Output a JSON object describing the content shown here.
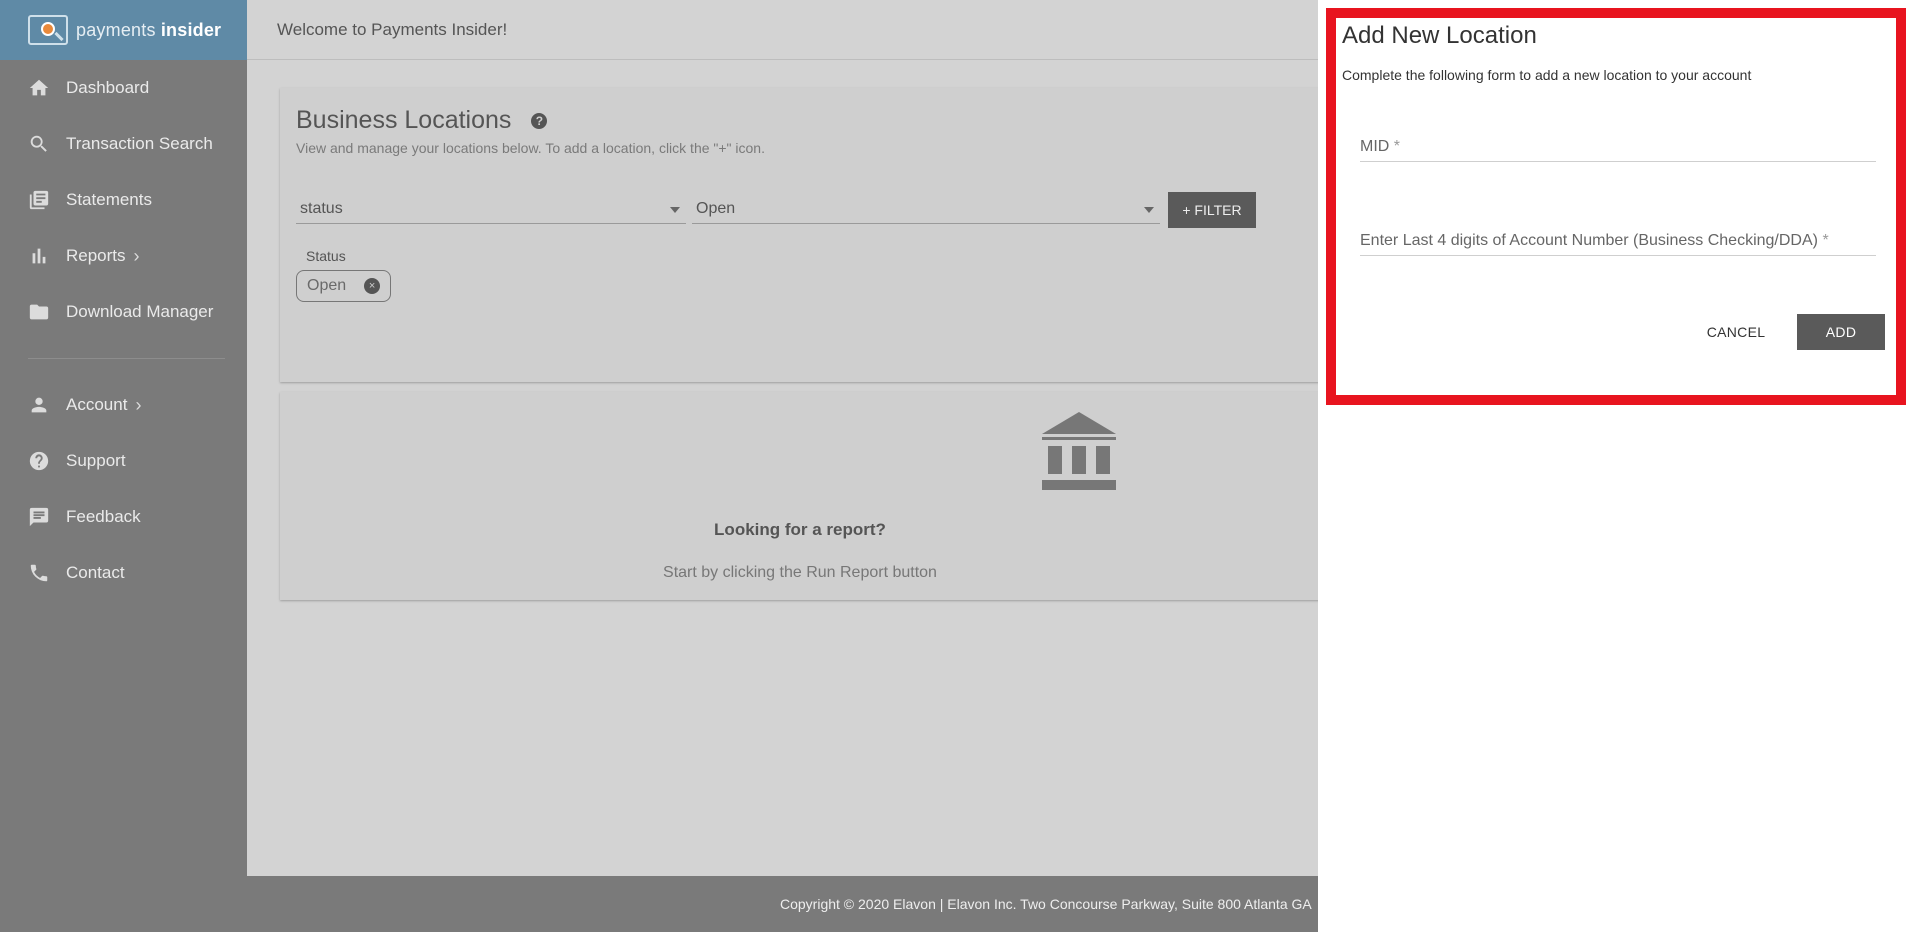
{
  "sidebar": {
    "logo_text_light": "payments ",
    "logo_text_bold": "insider",
    "items": [
      {
        "label": "Dashboard",
        "icon": "home-icon"
      },
      {
        "label": "Transaction Search",
        "icon": "search-icon"
      },
      {
        "label": "Statements",
        "icon": "statements-icon"
      },
      {
        "label": "Reports",
        "icon": "bar-chart-icon",
        "chevron": "›"
      },
      {
        "label": "Download Manager",
        "icon": "folder-icon"
      }
    ],
    "items2": [
      {
        "label": "Account",
        "icon": "person-icon",
        "chevron": "›"
      },
      {
        "label": "Support",
        "icon": "help-circle-icon"
      },
      {
        "label": "Feedback",
        "icon": "feedback-icon"
      },
      {
        "label": "Contact",
        "icon": "phone-icon"
      }
    ]
  },
  "header": {
    "welcome": "Welcome to Payments Insider!"
  },
  "locations": {
    "title": "Business Locations",
    "help": "?",
    "subtitle": "View and manage your locations below. To add a location, click the \"+\" icon.",
    "filter_field": "status",
    "filter_value": "Open",
    "filter_button": "+ FILTER",
    "chip_label": "Status",
    "chip_value": "Open",
    "chip_remove": "×"
  },
  "empty_state": {
    "title": "Looking for a report?",
    "subtitle": "Start by clicking the Run Report button"
  },
  "footer": {
    "copyright": "Copyright © 2020 Elavon | Elavon Inc. Two Concourse Parkway, Suite 800 Atlanta GA"
  },
  "panel": {
    "title": "Add New Location",
    "subtitle": "Complete the following form to add a new location to your account",
    "mid_label": "MID",
    "account_label": "Enter Last 4 digits of Account Number (Business Checking/DDA)",
    "required_mark": "*",
    "cancel": "CANCEL",
    "add": "ADD"
  },
  "colors": {
    "highlight": "#e8141f",
    "sidebar": "#7a7a7a",
    "logo_bar": "#5f8aa6",
    "button": "#5a5a5a"
  }
}
